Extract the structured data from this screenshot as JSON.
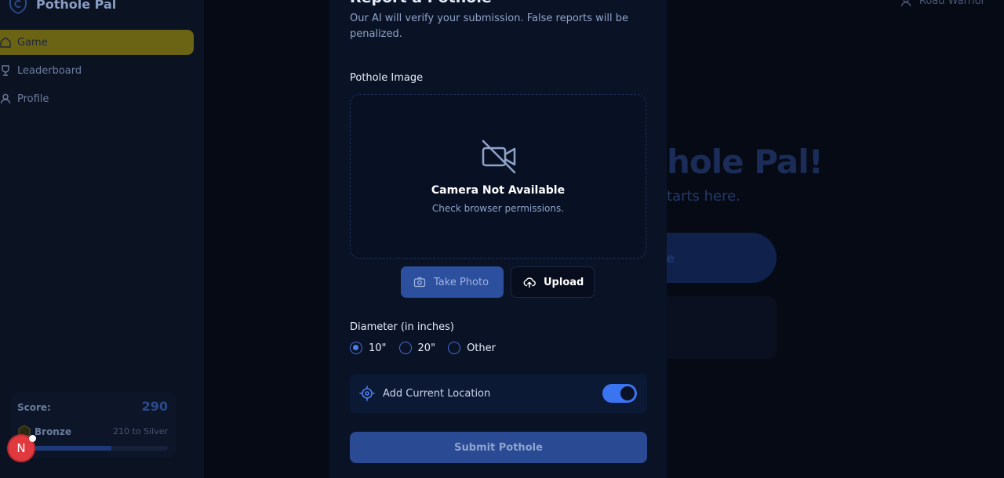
{
  "brand": {
    "name": "Pothole Pal"
  },
  "nav": {
    "items": [
      {
        "label": "Game",
        "icon": "home-icon",
        "active": true
      },
      {
        "label": "Leaderboard",
        "icon": "trophy-icon"
      },
      {
        "label": "Profile",
        "icon": "user-icon"
      }
    ]
  },
  "scorecard": {
    "score_label": "Score:",
    "score_value": "290",
    "tier": "Bronze",
    "next_tier": "210 to Silver",
    "progress_fraction": 0.58
  },
  "avatar": {
    "initial": "N"
  },
  "user": {
    "name": "Road Warrior"
  },
  "hero": {
    "title_partial": "hole Pal!",
    "subtitle_partial": "tarts here.",
    "button_partial": "e"
  },
  "modal": {
    "title": "Report a Pothole",
    "description": "Our AI will verify your submission. False reports will be penalized.",
    "image_label": "Pothole Image",
    "camera_title": "Camera Not Available",
    "camera_subtitle": "Check browser permissions.",
    "take_photo_label": "Take Photo",
    "upload_label": "Upload",
    "diameter_label": "Diameter (in inches)",
    "diameter_options": [
      {
        "label": "10\"",
        "checked": true
      },
      {
        "label": "20\"",
        "checked": false
      },
      {
        "label": "Other",
        "checked": false
      }
    ],
    "location_label": "Add Current Location",
    "location_enabled": true,
    "submit_label": "Submit Pothole"
  },
  "colors": {
    "accent": "#3a74f0",
    "active_nav": "#6b6414",
    "avatar": "#e0393e"
  }
}
